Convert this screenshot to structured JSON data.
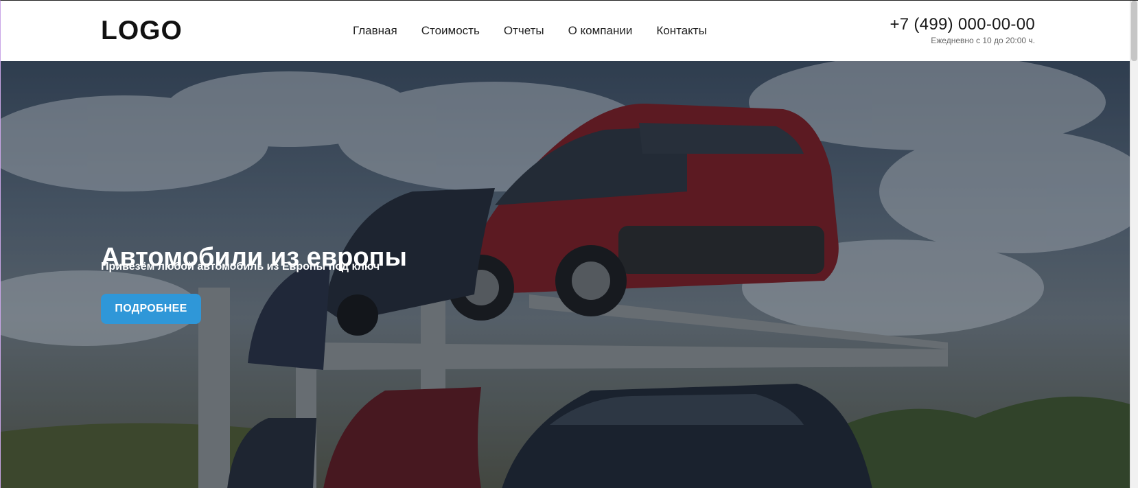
{
  "header": {
    "logo": "LOGO",
    "nav": [
      {
        "label": "Главная"
      },
      {
        "label": "Стоимость"
      },
      {
        "label": "Отчеты"
      },
      {
        "label": "О компании"
      },
      {
        "label": "Контакты"
      }
    ],
    "phone": "+7 (499) 000-00-00",
    "hours": "Ежедневно с 10 до 20:00 ч."
  },
  "hero": {
    "title": "Автомобили из европы",
    "subtitle": "Привезём любой автомобиль из Европы под ключ",
    "button_label": "ПОДРОБНЕЕ"
  },
  "colors": {
    "accent": "#2f97d8",
    "header_bg": "#ffffff",
    "text_dark": "#111111"
  }
}
